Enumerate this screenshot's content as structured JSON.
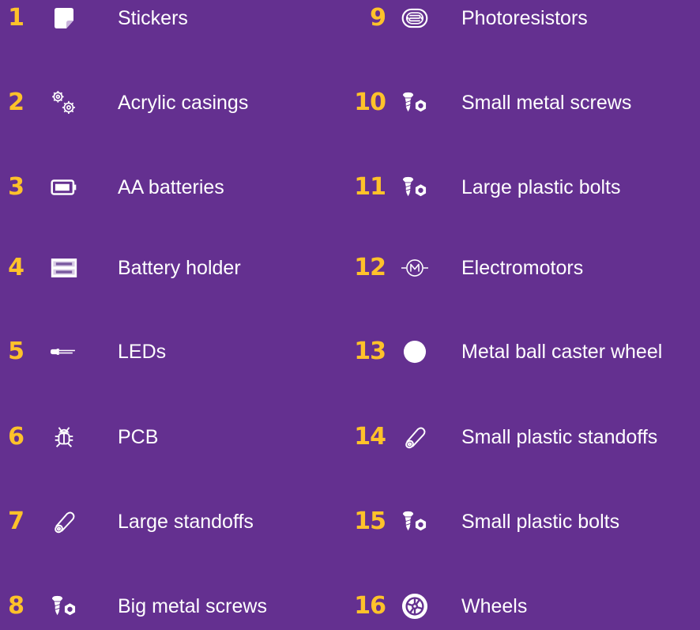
{
  "colors": {
    "background": "#643090",
    "number": "#FFC22A",
    "text": "#FFFFFF"
  },
  "left": [
    {
      "number": "1",
      "label": "Stickers",
      "icon": "sticker-icon"
    },
    {
      "number": "2",
      "label": "Acrylic casings",
      "icon": "gears-icon"
    },
    {
      "number": "3",
      "label": "AA batteries",
      "icon": "battery-icon"
    },
    {
      "number": "4",
      "label": "Battery holder",
      "icon": "battery-holder-icon"
    },
    {
      "number": "5",
      "label": "LEDs",
      "icon": "led-icon"
    },
    {
      "number": "6",
      "label": "PCB",
      "icon": "bug-icon"
    },
    {
      "number": "7",
      "label": "Large standoffs",
      "icon": "standoff-icon"
    },
    {
      "number": "8",
      "label": "Big metal screws",
      "icon": "screw-nut-icon"
    }
  ],
  "right": [
    {
      "number": "9",
      "label": "Photoresistors",
      "icon": "photoresistor-icon"
    },
    {
      "number": "10",
      "label": "Small metal screws",
      "icon": "screw-nut-icon"
    },
    {
      "number": "11",
      "label": "Large plastic bolts",
      "icon": "screw-nut-icon"
    },
    {
      "number": "12",
      "label": "Electromotors",
      "icon": "motor-icon"
    },
    {
      "number": "13",
      "label": "Metal ball caster wheel",
      "icon": "ball-icon"
    },
    {
      "number": "14",
      "label": "Small plastic standoffs",
      "icon": "standoff-icon"
    },
    {
      "number": "15",
      "label": "Small plastic bolts",
      "icon": "screw-nut-icon"
    },
    {
      "number": "16",
      "label": "Wheels",
      "icon": "wheel-icon"
    }
  ]
}
